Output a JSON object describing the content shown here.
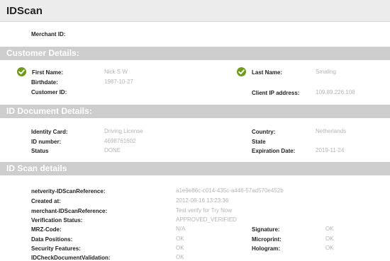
{
  "app": {
    "title": "IDScan"
  },
  "merchant": {
    "label": "Merchant ID:",
    "value": ""
  },
  "customer": {
    "section_title": "Customer Details:",
    "first_name_label": "First Name:",
    "first_name": "Nick S W",
    "last_name_label": "Last Name:",
    "last_name": "Smaling",
    "birthdate_label": "Birthdate:",
    "birthdate": "1987-10-27",
    "customer_id_label": "Customer ID:",
    "customer_id": "",
    "client_ip_label": "Client IP address:",
    "client_ip": "109.89.226.108",
    "check_icon": "check-circle-icon",
    "accent": "#6f9b1a"
  },
  "document": {
    "section_title": "ID Document Details:",
    "identity_card_label": "Identity Card:",
    "identity_card": "Driving License",
    "id_number_label": "ID number:",
    "id_number": "4698761602",
    "status_label": "Status",
    "status": "DONE",
    "country_label": "Country:",
    "country": "Netherlands",
    "state_label": "State",
    "state": "",
    "expiration_label": "Expiration Date:",
    "expiration": "2019-11-24"
  },
  "scan": {
    "section_title": "ID Scan details",
    "netverity_ref_label": "netverity-IDScanReference:",
    "netverity_ref": "a1e9e86c-c014-435c-a446-57ad570e452b",
    "created_label": "Created at:",
    "created": "2012-08-16 13:23:36",
    "merchant_ref_label": "merchant-IDScanReference:",
    "merchant_ref": "Test verify for Try Now",
    "verification_label": "Verification Status:",
    "verification": "APPROVED_VERIFIED",
    "mrz_label": "MRZ-Code:",
    "mrz": "N/A",
    "data_positions_label": "Data Positions:",
    "data_positions": "OK",
    "security_label": "Security Features:",
    "security": "OK",
    "idcheck_label": "IDCheckDocumentValidation:",
    "idcheck": "OK",
    "signature_label": "Signature:",
    "signature": "OK",
    "microprint_label": "Microprint:",
    "microprint": "OK",
    "hologram_label": "Hologram:",
    "hologram": "OK"
  }
}
